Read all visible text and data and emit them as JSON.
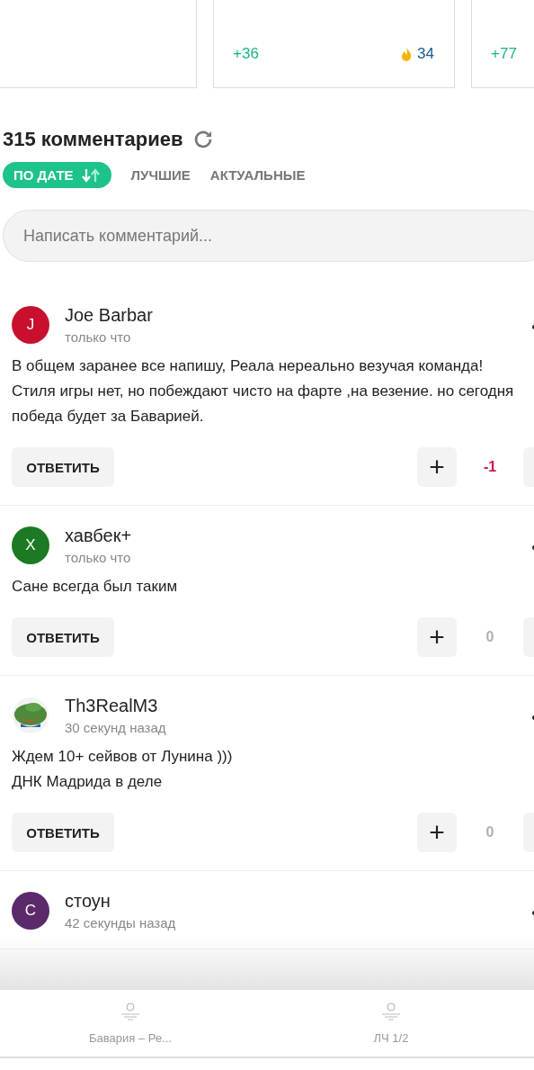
{
  "stat_cards": [
    {
      "delta": "+36",
      "hot": "34"
    },
    {
      "delta": "+77"
    }
  ],
  "comments_header": {
    "title": "315 комментариев"
  },
  "sort_tabs": [
    {
      "label": "ПО ДАТЕ",
      "selected": true
    },
    {
      "label": "ЛУЧШИЕ",
      "selected": false
    },
    {
      "label": "АКТУАЛЬНЫЕ",
      "selected": false
    }
  ],
  "comment_field": {
    "placeholder": "Написать комментарий..."
  },
  "comments": [
    {
      "avatar": {
        "kind": "letter",
        "letter": "J",
        "color": "#c8102e"
      },
      "author": "Joe Barbar",
      "time": "только что",
      "text": "В общем заранее все напишу, Реала нереально везучая команда!\nСтиля игры нет, но побеждают чисто на фарте ,на везение. но сегодня победа будет за Баварией.",
      "reply": "ОТВЕТИТЬ",
      "plus": "+",
      "score": {
        "value": "-1",
        "kind": "negative"
      }
    },
    {
      "avatar": {
        "kind": "letter",
        "letter": "X",
        "color": "#1b7a23"
      },
      "author": "хавбек+",
      "time": "только что",
      "text": "Сане всегда был таким",
      "reply": "ОТВЕТИТЬ",
      "plus": "+",
      "score": {
        "value": "0",
        "kind": "zero"
      }
    },
    {
      "author": "Th3RealM3",
      "time": "30 секунд назад",
      "text": "Ждем 10+ сейвов от Лунина )))\nДНК Мадрида в деле",
      "reply": "ОТВЕТИТЬ",
      "plus": "+",
      "score": {
        "value": "0",
        "kind": "zero"
      }
    },
    {
      "avatar": {
        "kind": "letter",
        "letter": "С",
        "color": "#5b2a6b"
      },
      "author": "стоун",
      "time": "42 секунды назад"
    }
  ],
  "bottom_tabs": [
    {
      "label": "Бавария – Ре..."
    },
    {
      "label": "ЛЧ 1/2"
    }
  ]
}
